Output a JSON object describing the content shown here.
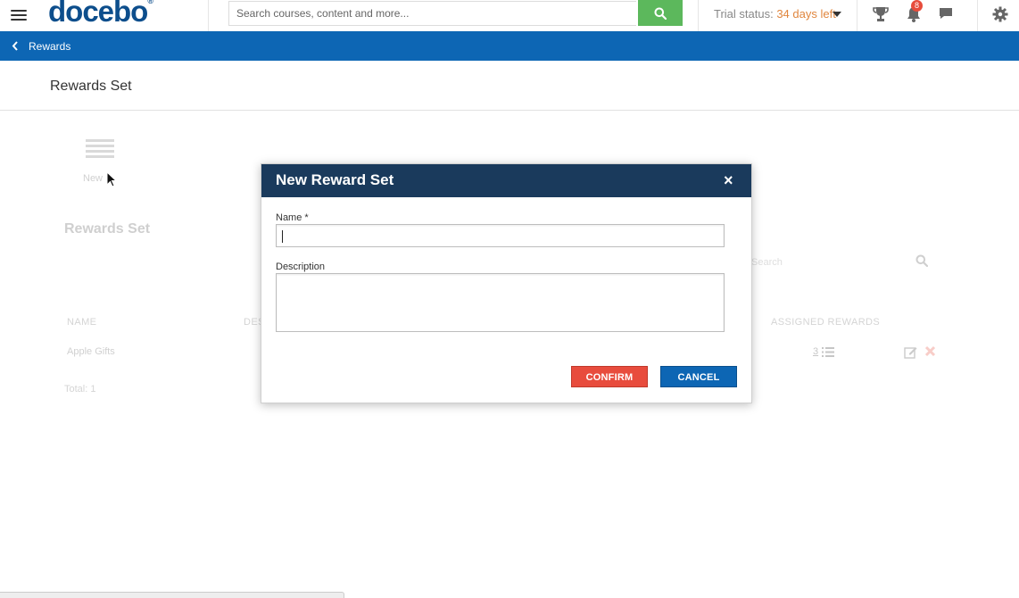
{
  "topbar": {
    "logo": "docebo",
    "logo_mark": "®",
    "search_placeholder": "Search courses, content and more...",
    "trial_prefix": "Trial status:",
    "trial_days": "34 days left",
    "notification_count": "8"
  },
  "breadcrumb": {
    "back_label": "Rewards"
  },
  "page": {
    "title": "Rewards Set",
    "new_label": "New",
    "section_title": "Rewards Set",
    "search_placeholder": "Search",
    "columns": {
      "name": "NAME",
      "description": "DES",
      "assigned_rewards": "ASSIGNED REWARDS"
    },
    "rows": [
      {
        "name": "Apple Gifts",
        "assigned_rewards": "3"
      }
    ],
    "total": "Total: 1"
  },
  "modal": {
    "title": "New Reward Set",
    "close_glyph": "×",
    "name_label": "Name *",
    "name_value": "",
    "description_label": "Description",
    "description_value": "",
    "confirm_label": "CONFIRM",
    "cancel_label": "CANCEL"
  },
  "colors": {
    "brand_blue": "#0d66b4",
    "modal_header": "#1a3a5c",
    "search_green": "#5cb85c",
    "confirm_red": "#e84c3d",
    "trial_orange": "#e0863e"
  }
}
